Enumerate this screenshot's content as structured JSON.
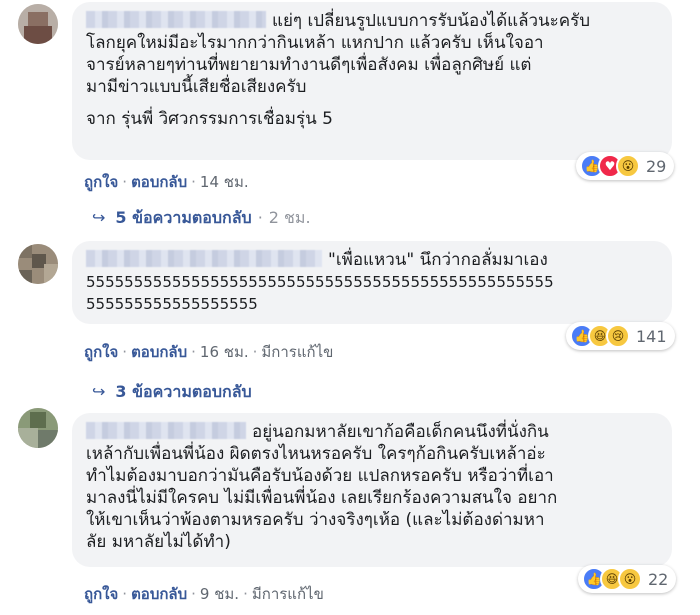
{
  "comments": [
    {
      "body_lines": [
        "แย่ๆ เปลี่ยนรูปแบบการรับน้องได้แล้วนะครับ",
        "โลกยุคใหม่มีอะไรมากกว่ากินเหล้า แหกปาก แล้วครับ เห็นใจอา",
        "จารย์หลายๆท่านที่พยายามทำงานดีๆเพื่อสังคม เพื่อลูกศิษย์ แต่",
        "มามีข่าวแบบนี้เสียชื่อเสียงครับ"
      ],
      "signature": "จาก รุ่นพี่ วิศวกรรมการเชื่อมรุ่น 5",
      "reactions": {
        "icons": [
          "like-icon",
          "love-icon",
          "wow-icon"
        ],
        "count": "29"
      },
      "footer": {
        "like": "ถูกใจ",
        "reply": "ตอบกลับ",
        "time": "14 ชม.",
        "edited": ""
      },
      "replies": {
        "label": "5 ข้อความตอบกลับ",
        "time": "2 ชม."
      }
    },
    {
      "body_lines": [
        "\"เพื่อแหวน\" นึกว่ากอลั่มมาเอง",
        "5555555555555555555555555555555555555555555555555",
        "555555555555555555"
      ],
      "reactions": {
        "icons": [
          "like-icon",
          "haha-icon",
          "sad-icon"
        ],
        "count": "141"
      },
      "footer": {
        "like": "ถูกใจ",
        "reply": "ตอบกลับ",
        "time": "16 ชม.",
        "edited": "มีการแก้ไข"
      },
      "replies": {
        "label": "3 ข้อความตอบกลับ",
        "time": ""
      }
    },
    {
      "body_lines": [
        "อยู่นอกมหาลัยเขาก้อคือเด็กคนนึงที่นั่งกิน",
        "เหล้ากับเพื่อนพี่น้อง ผิดตรงไหนหรอครับ ใครๆก้อกินครับเหล้าอ่ะ",
        "ทำไมต้องมาบอกว่ามันคือรับน้องด้วย แปลกหรอครับ หรือว่าที่เอา",
        "มาลงนี่ไม่มีใครคบ ไม่มีเพื่อนพี่น้อง เลยเรียกร้องความสนใจ อยาก",
        "ให้เขาเห็นว่าพ้องตามหรอครับ ว่างจริงๆเห้อ (และไม่ต้องด่ามหา",
        "ลัย มหาลัยไม่ได้ทำ)"
      ],
      "reactions": {
        "icons": [
          "like-icon",
          "haha-icon",
          "wow-icon"
        ],
        "count": "22"
      },
      "footer": {
        "like": "ถูกใจ",
        "reply": "ตอบกลับ",
        "time": "9 ชม.",
        "edited": "มีการแก้ไข"
      }
    }
  ],
  "colors": {
    "link": "#385898",
    "bubble": "#f2f3f5",
    "meta": "#606770"
  }
}
